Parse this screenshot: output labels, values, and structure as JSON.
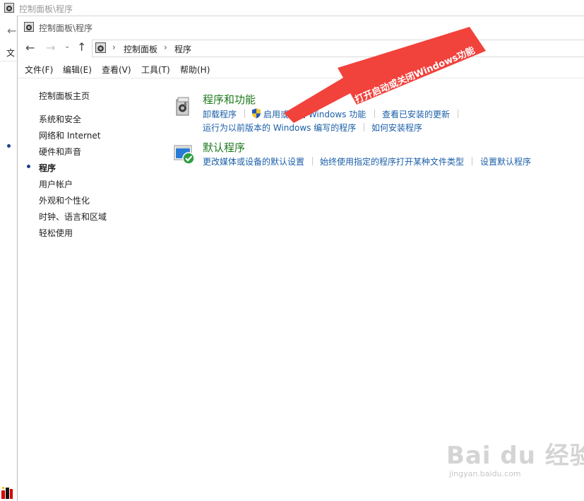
{
  "background_window": {
    "title": "控制面板\\程序",
    "menu_fragment": "文"
  },
  "window": {
    "title": "控制面板\\程序"
  },
  "address_bar": {
    "crumbs": [
      "控制面板",
      "程序"
    ]
  },
  "menu": {
    "items": [
      "文件(F)",
      "编辑(E)",
      "查看(V)",
      "工具(T)",
      "帮助(H)"
    ]
  },
  "left_nav": {
    "home": "控制面板主页",
    "items": [
      "系统和安全",
      "网络和 Internet",
      "硬件和声音",
      "程序",
      "用户帐户",
      "外观和个性化",
      "时钟、语言和区域",
      "轻松使用"
    ],
    "current": "程序"
  },
  "categories": {
    "programs_features": {
      "title": "程序和功能",
      "links": [
        "卸载程序",
        "启用或关闭 Windows 功能",
        "查看已安装的更新",
        "运行为以前版本的 Windows 编写的程序",
        "如何安装程序"
      ]
    },
    "default_programs": {
      "title": "默认程序",
      "links": [
        "更改媒体或设备的默认设置",
        "始终使用指定的程序打开某种文件类型",
        "设置默认程序"
      ]
    }
  },
  "annotation": {
    "text": "打开启动或关闭Windows功能",
    "color": "#f2423c"
  },
  "watermark": {
    "logo": "Bai du 经验",
    "url": "jingyan.baidu.com"
  },
  "colors": {
    "link": "#1a5ea8",
    "category_title": "#1e7a1e",
    "nav_bullet": "#1e3f8a"
  }
}
